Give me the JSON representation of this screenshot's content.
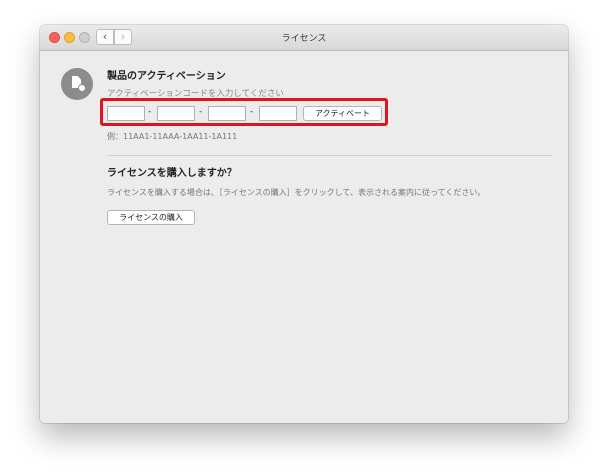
{
  "window": {
    "title": "ライセンス",
    "nav": {
      "back_icon": "chevron-left-icon",
      "forward_icon": "chevron-right-icon"
    }
  },
  "activation": {
    "heading": "製品のアクティベーション",
    "instruction": "アクティベーションコードを入力してください",
    "fields": [
      "",
      "",
      "",
      ""
    ],
    "separator": "-",
    "activate_button": "アクティベート",
    "example": "例：11AA1-11AAA-1AA11-1A111"
  },
  "purchase": {
    "heading": "ライセンスを購入しますか？",
    "description": "ライセンスを購入する場合は、［ライセンスの購入］をクリックして、表示される案内に従ってください。",
    "button": "ライセンスの購入"
  },
  "colors": {
    "highlight": "#e0141e",
    "close": "#fc605b",
    "minimize": "#fdbc40",
    "zoom_disabled": "#cfcfcf"
  }
}
